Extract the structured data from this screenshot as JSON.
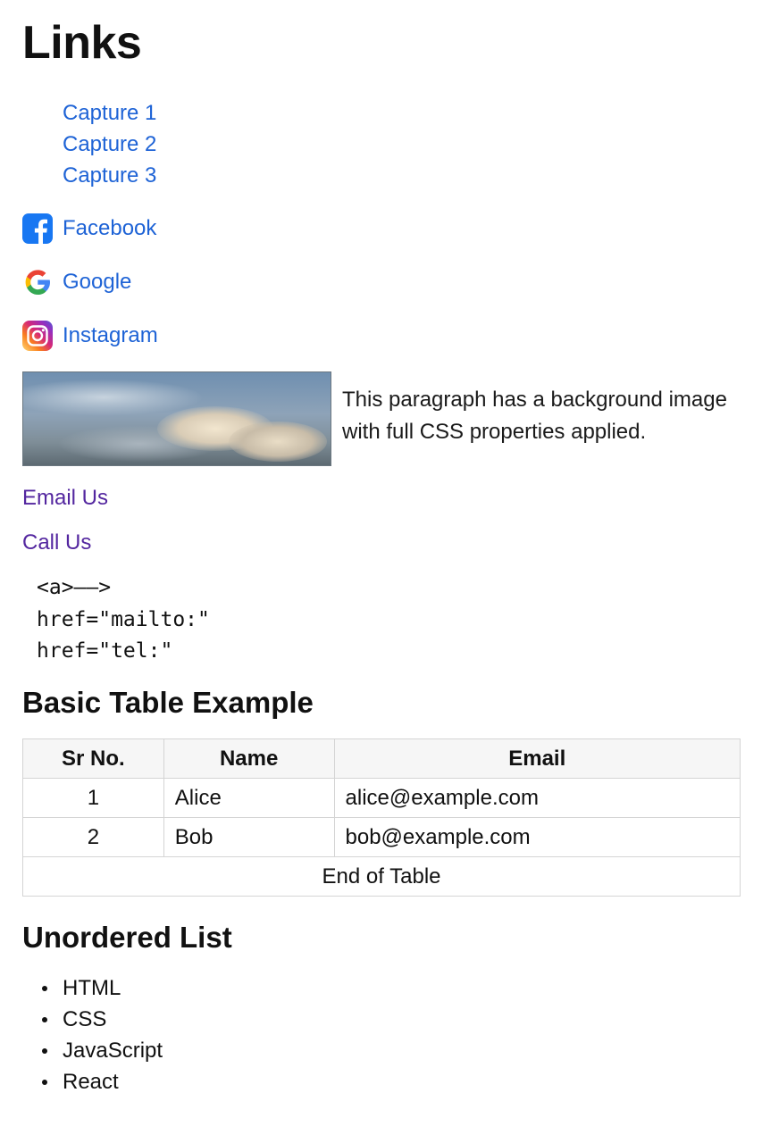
{
  "page": {
    "title": "Links"
  },
  "captures": [
    {
      "label": "Capture 1"
    },
    {
      "label": "Capture 2"
    },
    {
      "label": "Capture 3"
    }
  ],
  "social": {
    "facebook": {
      "label": "Facebook",
      "icon": "facebook-icon",
      "color": "#1877f2"
    },
    "google": {
      "label": "Google",
      "icon": "google-icon"
    },
    "instagram": {
      "label": "Instagram",
      "icon": "instagram-icon"
    }
  },
  "image_paragraph": {
    "image": "sky-with-clouds",
    "text": "This paragraph has a background image with full CSS properties applied."
  },
  "contact": {
    "email_label": "Email Us",
    "call_label": "Call Us"
  },
  "code_lines": [
    "<a>——>",
    "href=\"mailto:\"",
    "href=\"tel:\""
  ],
  "table_section": {
    "heading": "Basic Table Example",
    "headers": [
      "Sr No.",
      "Name",
      "Email"
    ],
    "rows": [
      [
        "1",
        "Alice",
        "alice@example.com"
      ],
      [
        "2",
        "Bob",
        "bob@example.com"
      ]
    ],
    "footer": "End of Table"
  },
  "list_section": {
    "heading": "Unordered List",
    "items": [
      "HTML",
      "CSS",
      "JavaScript",
      "React"
    ]
  },
  "colors": {
    "link": "#1e63d6",
    "visited_link": "#53269f",
    "table_border": "#d4d4d4",
    "table_header_bg": "#f6f6f6"
  }
}
